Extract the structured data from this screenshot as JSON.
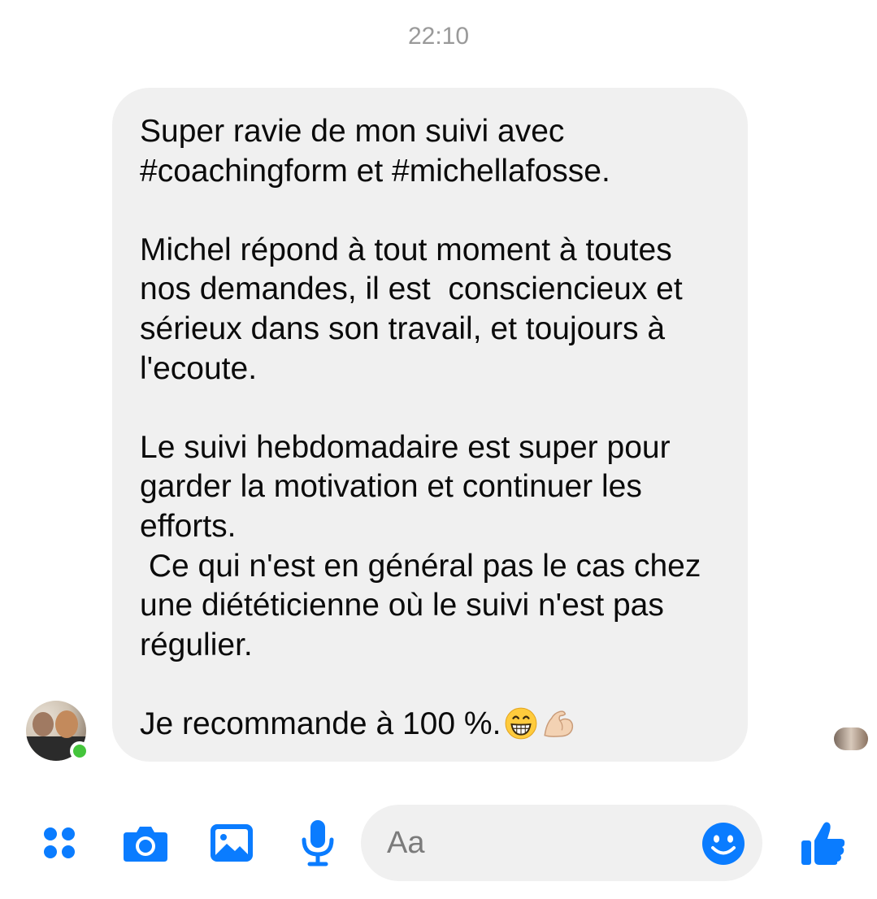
{
  "conversation": {
    "timestamp": "22:10",
    "message": {
      "text": "Super ravie de mon suivi avec\n#coachingform et #michellafosse.\n\nMichel répond à tout moment à toutes\nnos demandes, il est  consciencieux et\nsérieux dans son travail, et toujours à\nl'ecoute.\n\nLe suivi hebdomadaire est super pour\ngarder la motivation et continuer les\nefforts.\n Ce qui n'est en général pas le cas chez\nune diététicienne où le suivi n'est pas\nrégulier.\n\nJe recommande à 100 %.",
      "emojis": [
        "grinning-face-emoji",
        "flexed-biceps-emoji"
      ]
    },
    "sender_status": "online"
  },
  "composer": {
    "placeholder": "Aa",
    "icons": [
      "menu-dots-icon",
      "camera-icon",
      "gallery-icon",
      "microphone-icon",
      "smiley-icon",
      "thumbs-up-icon"
    ]
  },
  "colors": {
    "accent": "#0a7cff",
    "bubble": "#f0f0f0",
    "online": "#44c53b",
    "timestamp": "#9a9a9a"
  }
}
